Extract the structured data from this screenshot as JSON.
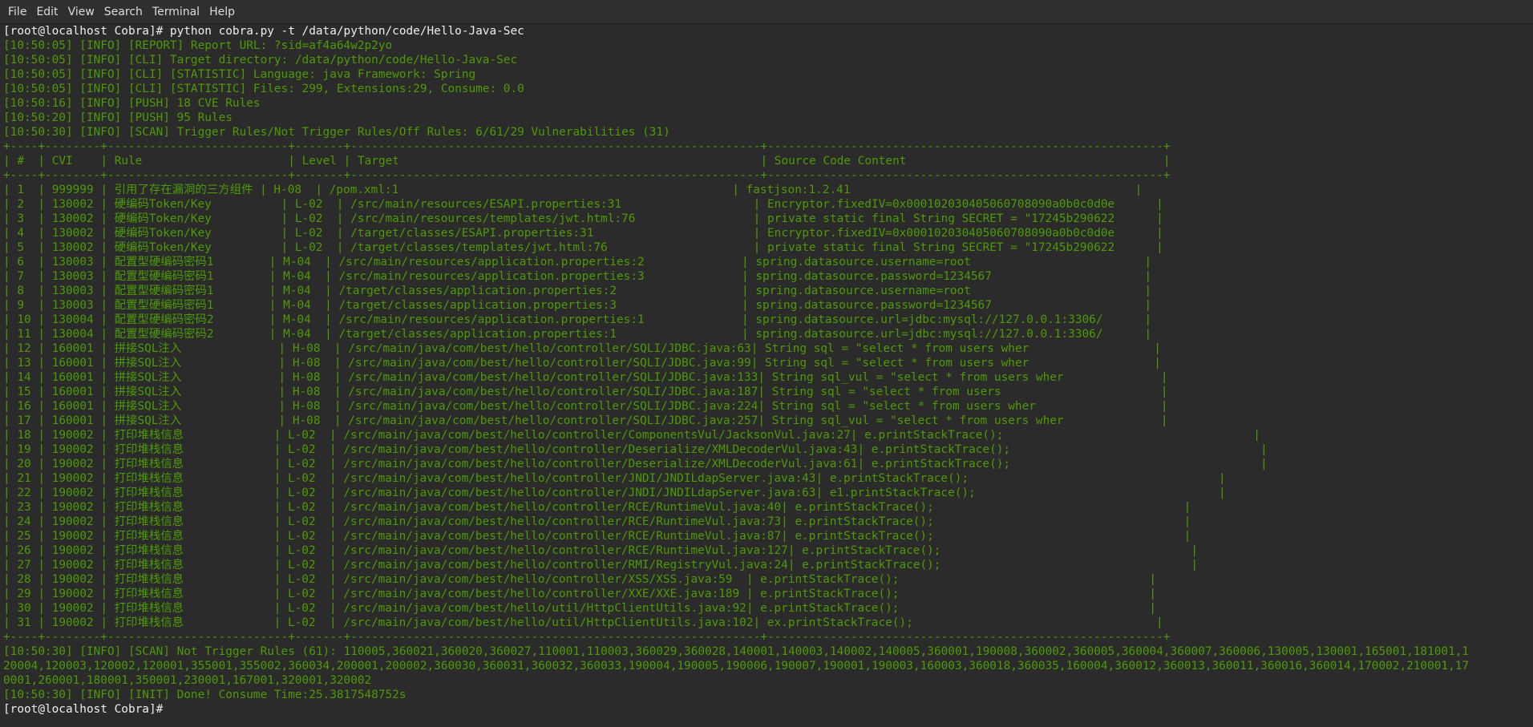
{
  "menu": [
    "File",
    "Edit",
    "View",
    "Search",
    "Terminal",
    "Help"
  ],
  "terminal": {
    "command": "[root@localhost Cobra]# python cobra.py -t /data/python/code/Hello-Java-Sec",
    "log": [
      "[10:50:05] [INFO] [REPORT] Report URL: ?sid=af4a64w2p2yo",
      "[10:50:05] [INFO] [CLI] Target directory: /data/python/code/Hello-Java-Sec",
      "[10:50:05] [INFO] [CLI] [STATISTIC] Language: java Framework: Spring",
      "[10:50:05] [INFO] [CLI] [STATISTIC] Files: 299, Extensions:29, Consume: 0.0",
      "[10:50:16] [INFO] [PUSH] 18 CVE Rules",
      "[10:50:20] [INFO] [PUSH] 95 Rules",
      "[10:50:30] [INFO] [SCAN] Trigger Rules/Not Trigger Rules/Off Rules: 6/61/29 Vulnerabilities (31)"
    ],
    "table": {
      "headers": [
        "#",
        "CVI",
        "Rule",
        "Level",
        "Target",
        "Source Code Content"
      ],
      "rows": [
        [
          "1",
          "999999",
          "引用了存在漏洞的三方组件",
          "H-08",
          "/pom.xml:1",
          "fastjson:1.2.41"
        ],
        [
          "2",
          "130002",
          "硬编码Token/Key",
          "L-02",
          "/src/main/resources/ESAPI.properties:31",
          "Encryptor.fixedIV=0x000102030405060708090a0b0c0d0e"
        ],
        [
          "3",
          "130002",
          "硬编码Token/Key",
          "L-02",
          "/src/main/resources/templates/jwt.html:76",
          "private static final String SECRET = \"17245b290622"
        ],
        [
          "4",
          "130002",
          "硬编码Token/Key",
          "L-02",
          "/target/classes/ESAPI.properties:31",
          "Encryptor.fixedIV=0x000102030405060708090a0b0c0d0e"
        ],
        [
          "5",
          "130002",
          "硬编码Token/Key",
          "L-02",
          "/target/classes/templates/jwt.html:76",
          "private static final String SECRET = \"17245b290622"
        ],
        [
          "6",
          "130003",
          "配置型硬编码密码1",
          "M-04",
          "/src/main/resources/application.properties:2",
          "spring.datasource.username=root"
        ],
        [
          "7",
          "130003",
          "配置型硬编码密码1",
          "M-04",
          "/src/main/resources/application.properties:3",
          "spring.datasource.password=1234567"
        ],
        [
          "8",
          "130003",
          "配置型硬编码密码1",
          "M-04",
          "/target/classes/application.properties:2",
          "spring.datasource.username=root"
        ],
        [
          "9",
          "130003",
          "配置型硬编码密码1",
          "M-04",
          "/target/classes/application.properties:3",
          "spring.datasource.password=1234567"
        ],
        [
          "10",
          "130004",
          "配置型硬编码密码2",
          "M-04",
          "/src/main/resources/application.properties:1",
          "spring.datasource.url=jdbc:mysql://127.0.0.1:3306/"
        ],
        [
          "11",
          "130004",
          "配置型硬编码密码2",
          "M-04",
          "/target/classes/application.properties:1",
          "spring.datasource.url=jdbc:mysql://127.0.0.1:3306/"
        ],
        [
          "12",
          "160001",
          "拼接SQL注入",
          "H-08",
          "/src/main/java/com/best/hello/controller/SQLI/JDBC.java:63",
          "String sql = \"select * from users wher"
        ],
        [
          "13",
          "160001",
          "拼接SQL注入",
          "H-08",
          "/src/main/java/com/best/hello/controller/SQLI/JDBC.java:99",
          "String sql = \"select * from users wher"
        ],
        [
          "14",
          "160001",
          "拼接SQL注入",
          "H-08",
          "/src/main/java/com/best/hello/controller/SQLI/JDBC.java:133",
          "String sql_vul = \"select * from users wher"
        ],
        [
          "15",
          "160001",
          "拼接SQL注入",
          "H-08",
          "/src/main/java/com/best/hello/controller/SQLI/JDBC.java:187",
          "String sql = \"select * from users"
        ],
        [
          "16",
          "160001",
          "拼接SQL注入",
          "H-08",
          "/src/main/java/com/best/hello/controller/SQLI/JDBC.java:224",
          "String sql = \"select * from users wher"
        ],
        [
          "17",
          "160001",
          "拼接SQL注入",
          "H-08",
          "/src/main/java/com/best/hello/controller/SQLI/JDBC.java:257",
          "String sql_vul = \"select * from users wher"
        ],
        [
          "18",
          "190002",
          "打印堆栈信息",
          "L-02",
          "/src/main/java/com/best/hello/controller/ComponentsVul/JacksonVul.java:27",
          "e.printStackTrace();"
        ],
        [
          "19",
          "190002",
          "打印堆栈信息",
          "L-02",
          "/src/main/java/com/best/hello/controller/Deserialize/XMLDecoderVul.java:43",
          "e.printStackTrace();"
        ],
        [
          "20",
          "190002",
          "打印堆栈信息",
          "L-02",
          "/src/main/java/com/best/hello/controller/Deserialize/XMLDecoderVul.java:61",
          "e.printStackTrace();"
        ],
        [
          "21",
          "190002",
          "打印堆栈信息",
          "L-02",
          "/src/main/java/com/best/hello/controller/JNDI/JNDILdapServer.java:43",
          "e.printStackTrace();"
        ],
        [
          "22",
          "190002",
          "打印堆栈信息",
          "L-02",
          "/src/main/java/com/best/hello/controller/JNDI/JNDILdapServer.java:63",
          "e1.printStackTrace();"
        ],
        [
          "23",
          "190002",
          "打印堆栈信息",
          "L-02",
          "/src/main/java/com/best/hello/controller/RCE/RuntimeVul.java:40",
          "e.printStackTrace();"
        ],
        [
          "24",
          "190002",
          "打印堆栈信息",
          "L-02",
          "/src/main/java/com/best/hello/controller/RCE/RuntimeVul.java:73",
          "e.printStackTrace();"
        ],
        [
          "25",
          "190002",
          "打印堆栈信息",
          "L-02",
          "/src/main/java/com/best/hello/controller/RCE/RuntimeVul.java:87",
          "e.printStackTrace();"
        ],
        [
          "26",
          "190002",
          "打印堆栈信息",
          "L-02",
          "/src/main/java/com/best/hello/controller/RCE/RuntimeVul.java:127",
          "e.printStackTrace();"
        ],
        [
          "27",
          "190002",
          "打印堆栈信息",
          "L-02",
          "/src/main/java/com/best/hello/controller/RMI/RegistryVul.java:24",
          "e.printStackTrace();"
        ],
        [
          "28",
          "190002",
          "打印堆栈信息",
          "L-02",
          "/src/main/java/com/best/hello/controller/XSS/XSS.java:59",
          "e.printStackTrace();"
        ],
        [
          "29",
          "190002",
          "打印堆栈信息",
          "L-02",
          "/src/main/java/com/best/hello/controller/XXE/XXE.java:189",
          "e.printStackTrace();"
        ],
        [
          "30",
          "190002",
          "打印堆栈信息",
          "L-02",
          "/src/main/java/com/best/hello/util/HttpClientUtils.java:92",
          "e.printStackTrace();"
        ],
        [
          "31",
          "190002",
          "打印堆栈信息",
          "L-02",
          "/src/main/java/com/best/hello/util/HttpClientUtils.java:102",
          "ex.printStackTrace();"
        ]
      ]
    },
    "not_trigger": [
      "[10:50:30] [INFO] [SCAN] Not Trigger Rules (61): 110005,360021,360020,360027,110001,110003,360029,360028,140001,140003,140002,140005,360001,190008,360002,360005,360004,360007,360006,130005,130001,165001,181001,1",
      "20004,120003,120002,120001,355001,355002,360034,200001,200002,360030,360031,360032,360033,190004,190005,190006,190007,190001,190003,160003,360018,360035,160004,360012,360013,360011,360016,360014,170002,210001,17",
      "0001,260001,180001,350001,230001,167001,320001,320002"
    ],
    "done": "[10:50:30] [INFO] [INIT] Done! Consume Time:25.3817548752s",
    "prompt": "[root@localhost Cobra]# "
  },
  "colors": {
    "prompt": "#eeeeec",
    "output": "#4e9a06",
    "background": "#2b2b2b"
  }
}
